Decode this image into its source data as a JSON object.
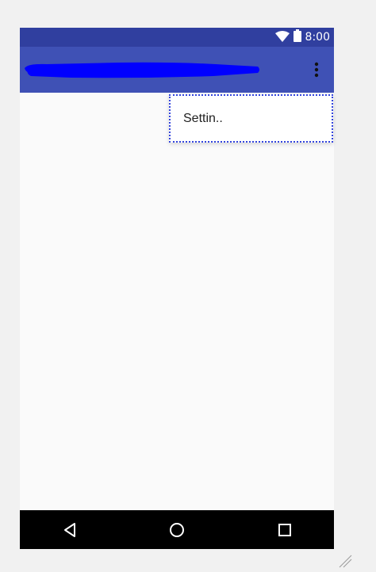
{
  "status_bar": {
    "time": "8:00",
    "icons": [
      "wifi-icon",
      "battery-icon"
    ]
  },
  "app_bar": {
    "title_redacted": true,
    "overflow_icon": "more-vert-icon"
  },
  "menu": {
    "items": [
      {
        "label": "Settin.."
      }
    ]
  },
  "nav_bar": {
    "buttons": [
      "back-icon",
      "home-icon",
      "recents-icon"
    ]
  },
  "colors": {
    "status_bar": "#303f9f",
    "app_bar": "#3f51b5",
    "redaction": "#0000ff",
    "menu_border": "#3344dd",
    "background": "#fafafa",
    "nav_bar": "#000000"
  }
}
